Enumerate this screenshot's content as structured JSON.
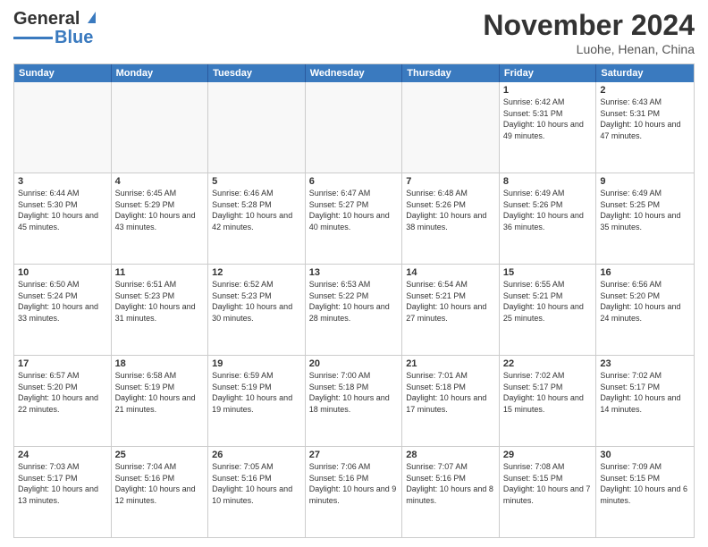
{
  "header": {
    "logo_line1": "General",
    "logo_line2": "Blue",
    "month_title": "November 2024",
    "location": "Luohe, Henan, China"
  },
  "weekdays": [
    "Sunday",
    "Monday",
    "Tuesday",
    "Wednesday",
    "Thursday",
    "Friday",
    "Saturday"
  ],
  "rows": [
    {
      "cells": [
        {
          "day": "",
          "empty": true
        },
        {
          "day": "",
          "empty": true
        },
        {
          "day": "",
          "empty": true
        },
        {
          "day": "",
          "empty": true
        },
        {
          "day": "",
          "empty": true
        },
        {
          "day": "1",
          "sunrise": "6:42 AM",
          "sunset": "5:31 PM",
          "daylight": "10 hours and 49 minutes."
        },
        {
          "day": "2",
          "sunrise": "6:43 AM",
          "sunset": "5:31 PM",
          "daylight": "10 hours and 47 minutes."
        }
      ]
    },
    {
      "cells": [
        {
          "day": "3",
          "sunrise": "6:44 AM",
          "sunset": "5:30 PM",
          "daylight": "10 hours and 45 minutes."
        },
        {
          "day": "4",
          "sunrise": "6:45 AM",
          "sunset": "5:29 PM",
          "daylight": "10 hours and 43 minutes."
        },
        {
          "day": "5",
          "sunrise": "6:46 AM",
          "sunset": "5:28 PM",
          "daylight": "10 hours and 42 minutes."
        },
        {
          "day": "6",
          "sunrise": "6:47 AM",
          "sunset": "5:27 PM",
          "daylight": "10 hours and 40 minutes."
        },
        {
          "day": "7",
          "sunrise": "6:48 AM",
          "sunset": "5:26 PM",
          "daylight": "10 hours and 38 minutes."
        },
        {
          "day": "8",
          "sunrise": "6:49 AM",
          "sunset": "5:26 PM",
          "daylight": "10 hours and 36 minutes."
        },
        {
          "day": "9",
          "sunrise": "6:49 AM",
          "sunset": "5:25 PM",
          "daylight": "10 hours and 35 minutes."
        }
      ]
    },
    {
      "cells": [
        {
          "day": "10",
          "sunrise": "6:50 AM",
          "sunset": "5:24 PM",
          "daylight": "10 hours and 33 minutes."
        },
        {
          "day": "11",
          "sunrise": "6:51 AM",
          "sunset": "5:23 PM",
          "daylight": "10 hours and 31 minutes."
        },
        {
          "day": "12",
          "sunrise": "6:52 AM",
          "sunset": "5:23 PM",
          "daylight": "10 hours and 30 minutes."
        },
        {
          "day": "13",
          "sunrise": "6:53 AM",
          "sunset": "5:22 PM",
          "daylight": "10 hours and 28 minutes."
        },
        {
          "day": "14",
          "sunrise": "6:54 AM",
          "sunset": "5:21 PM",
          "daylight": "10 hours and 27 minutes."
        },
        {
          "day": "15",
          "sunrise": "6:55 AM",
          "sunset": "5:21 PM",
          "daylight": "10 hours and 25 minutes."
        },
        {
          "day": "16",
          "sunrise": "6:56 AM",
          "sunset": "5:20 PM",
          "daylight": "10 hours and 24 minutes."
        }
      ]
    },
    {
      "cells": [
        {
          "day": "17",
          "sunrise": "6:57 AM",
          "sunset": "5:20 PM",
          "daylight": "10 hours and 22 minutes."
        },
        {
          "day": "18",
          "sunrise": "6:58 AM",
          "sunset": "5:19 PM",
          "daylight": "10 hours and 21 minutes."
        },
        {
          "day": "19",
          "sunrise": "6:59 AM",
          "sunset": "5:19 PM",
          "daylight": "10 hours and 19 minutes."
        },
        {
          "day": "20",
          "sunrise": "7:00 AM",
          "sunset": "5:18 PM",
          "daylight": "10 hours and 18 minutes."
        },
        {
          "day": "21",
          "sunrise": "7:01 AM",
          "sunset": "5:18 PM",
          "daylight": "10 hours and 17 minutes."
        },
        {
          "day": "22",
          "sunrise": "7:02 AM",
          "sunset": "5:17 PM",
          "daylight": "10 hours and 15 minutes."
        },
        {
          "day": "23",
          "sunrise": "7:02 AM",
          "sunset": "5:17 PM",
          "daylight": "10 hours and 14 minutes."
        }
      ]
    },
    {
      "cells": [
        {
          "day": "24",
          "sunrise": "7:03 AM",
          "sunset": "5:17 PM",
          "daylight": "10 hours and 13 minutes."
        },
        {
          "day": "25",
          "sunrise": "7:04 AM",
          "sunset": "5:16 PM",
          "daylight": "10 hours and 12 minutes."
        },
        {
          "day": "26",
          "sunrise": "7:05 AM",
          "sunset": "5:16 PM",
          "daylight": "10 hours and 10 minutes."
        },
        {
          "day": "27",
          "sunrise": "7:06 AM",
          "sunset": "5:16 PM",
          "daylight": "10 hours and 9 minutes."
        },
        {
          "day": "28",
          "sunrise": "7:07 AM",
          "sunset": "5:16 PM",
          "daylight": "10 hours and 8 minutes."
        },
        {
          "day": "29",
          "sunrise": "7:08 AM",
          "sunset": "5:15 PM",
          "daylight": "10 hours and 7 minutes."
        },
        {
          "day": "30",
          "sunrise": "7:09 AM",
          "sunset": "5:15 PM",
          "daylight": "10 hours and 6 minutes."
        }
      ]
    }
  ]
}
